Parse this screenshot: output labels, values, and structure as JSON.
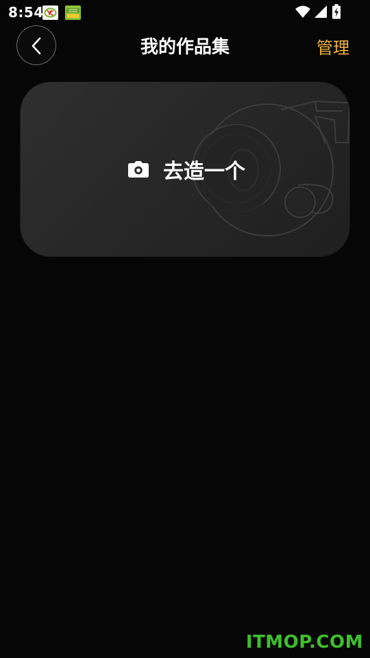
{
  "status_bar": {
    "time": "8:54",
    "notifications": [
      "yc-app-icon",
      "green-app-icon"
    ],
    "icons": [
      "wifi-icon",
      "signal-icon",
      "battery-charging-icon"
    ]
  },
  "header": {
    "title": "我的作品集",
    "back_icon": "chevron-left-icon",
    "manage_label": "管理",
    "accent_color": "#f2b43c"
  },
  "card": {
    "label": "去造一个",
    "icon": "camera-icon"
  },
  "watermark": {
    "text": "ITMOP.COM",
    "color": "#3fbf2d"
  }
}
